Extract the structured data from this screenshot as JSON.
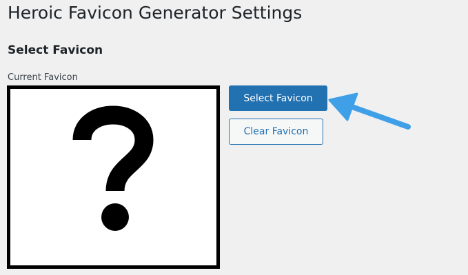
{
  "page": {
    "title": "Heroic Favicon Generator Settings"
  },
  "section": {
    "title": "Select Favicon",
    "current_label": "Current Favicon"
  },
  "favicon": {
    "icon": "question-mark-icon"
  },
  "buttons": {
    "select_label": "Select Favicon",
    "clear_label": "Clear Favicon"
  },
  "colors": {
    "primary": "#2271b1",
    "background": "#f0f0f1",
    "arrow": "#3fa0e8"
  }
}
